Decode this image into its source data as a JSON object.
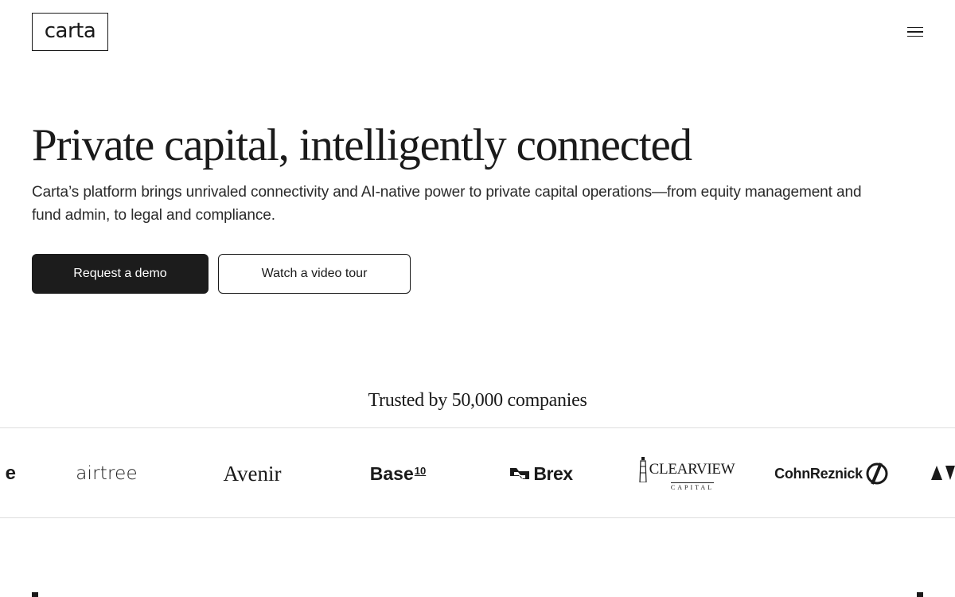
{
  "header": {
    "logo_text": "carta",
    "menu_icon": "hamburger-menu-icon"
  },
  "hero": {
    "title": "Private capital, intelligently connected",
    "subtitle": "Carta’s platform brings unrivaled connectivity and AI-native power to private capital operations—from equity management and fund admin, to legal and compliance.",
    "primary_button": "Request a demo",
    "secondary_button": "Watch a video tour"
  },
  "trusted": {
    "heading": "Trusted by 50,000 companies",
    "logos": {
      "partial_left": "e",
      "airtree": "airtree",
      "avenir": "Avenir",
      "base": "Base",
      "base_sup": "10",
      "brex": "Brex",
      "clearview": "CLEARVIEW",
      "clearview_sub": "CAPITAL",
      "cohnreznick": "CohnReznick"
    }
  },
  "colors": {
    "text": "#1a1a1a",
    "background": "#ffffff",
    "primary_button_bg": "#1c1c1c",
    "divider": "#dedede"
  }
}
